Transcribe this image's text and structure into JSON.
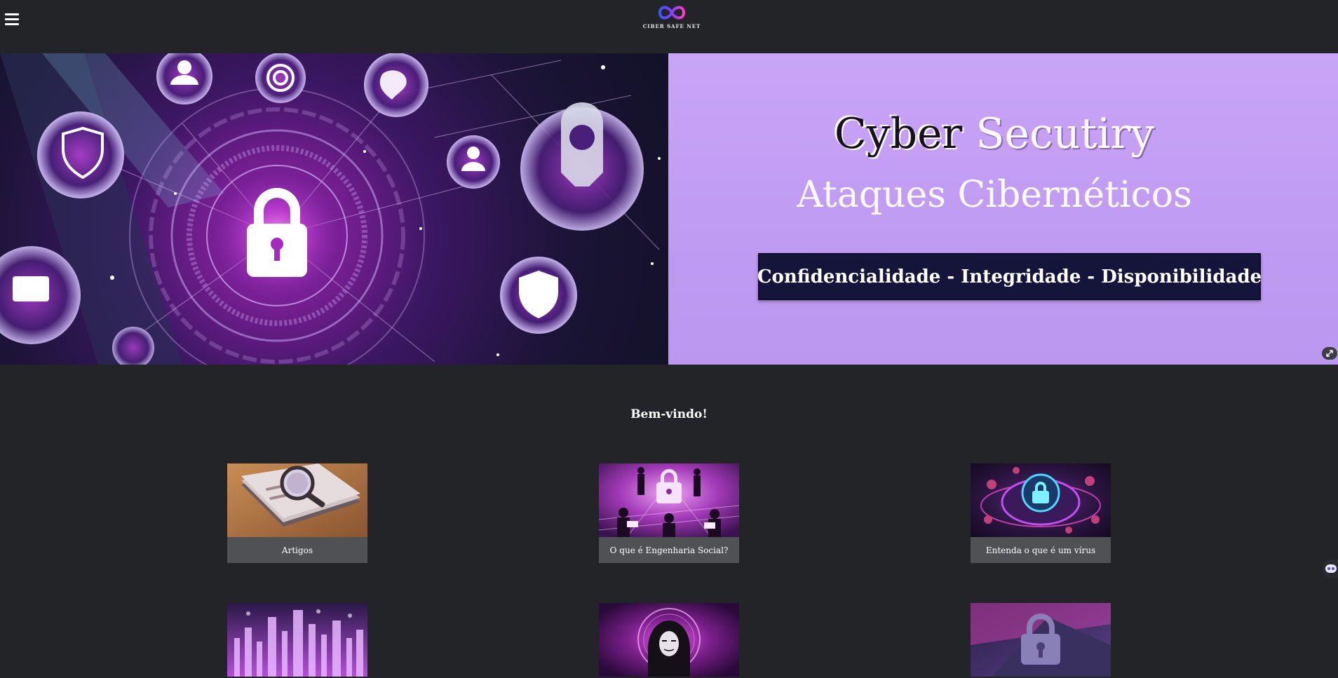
{
  "header": {
    "menu_icon": "hamburger-menu-icon",
    "logo_text": "CIBER SAFE NET",
    "logo_icon": "infinity-logo-icon"
  },
  "hero": {
    "title_part1": "Cyber",
    "title_part2": " Secutiry",
    "subtitle": "Ataques Cibernéticos",
    "banner": "Confidencialidade - Integridade - Disponibilidade",
    "expand_icon": "expand-icon",
    "colors": {
      "right_bg": "#c9a4f7",
      "banner_bg": "#15143b"
    }
  },
  "welcome": "Bem-vindo!",
  "cards": [
    {
      "caption": "Artigos",
      "icon": "magnifying-glass-image"
    },
    {
      "caption": "O que é Engenharia Social?",
      "icon": "hackers-lock-image"
    },
    {
      "caption": "Entenda o que é um vírus",
      "icon": "virus-lock-image"
    },
    {
      "caption": "",
      "icon": "digital-city-image"
    },
    {
      "caption": "",
      "icon": "hooded-hacker-image"
    },
    {
      "caption": "",
      "icon": "data-protection-lock-image"
    }
  ],
  "chat_icon": "chat-bot-icon"
}
